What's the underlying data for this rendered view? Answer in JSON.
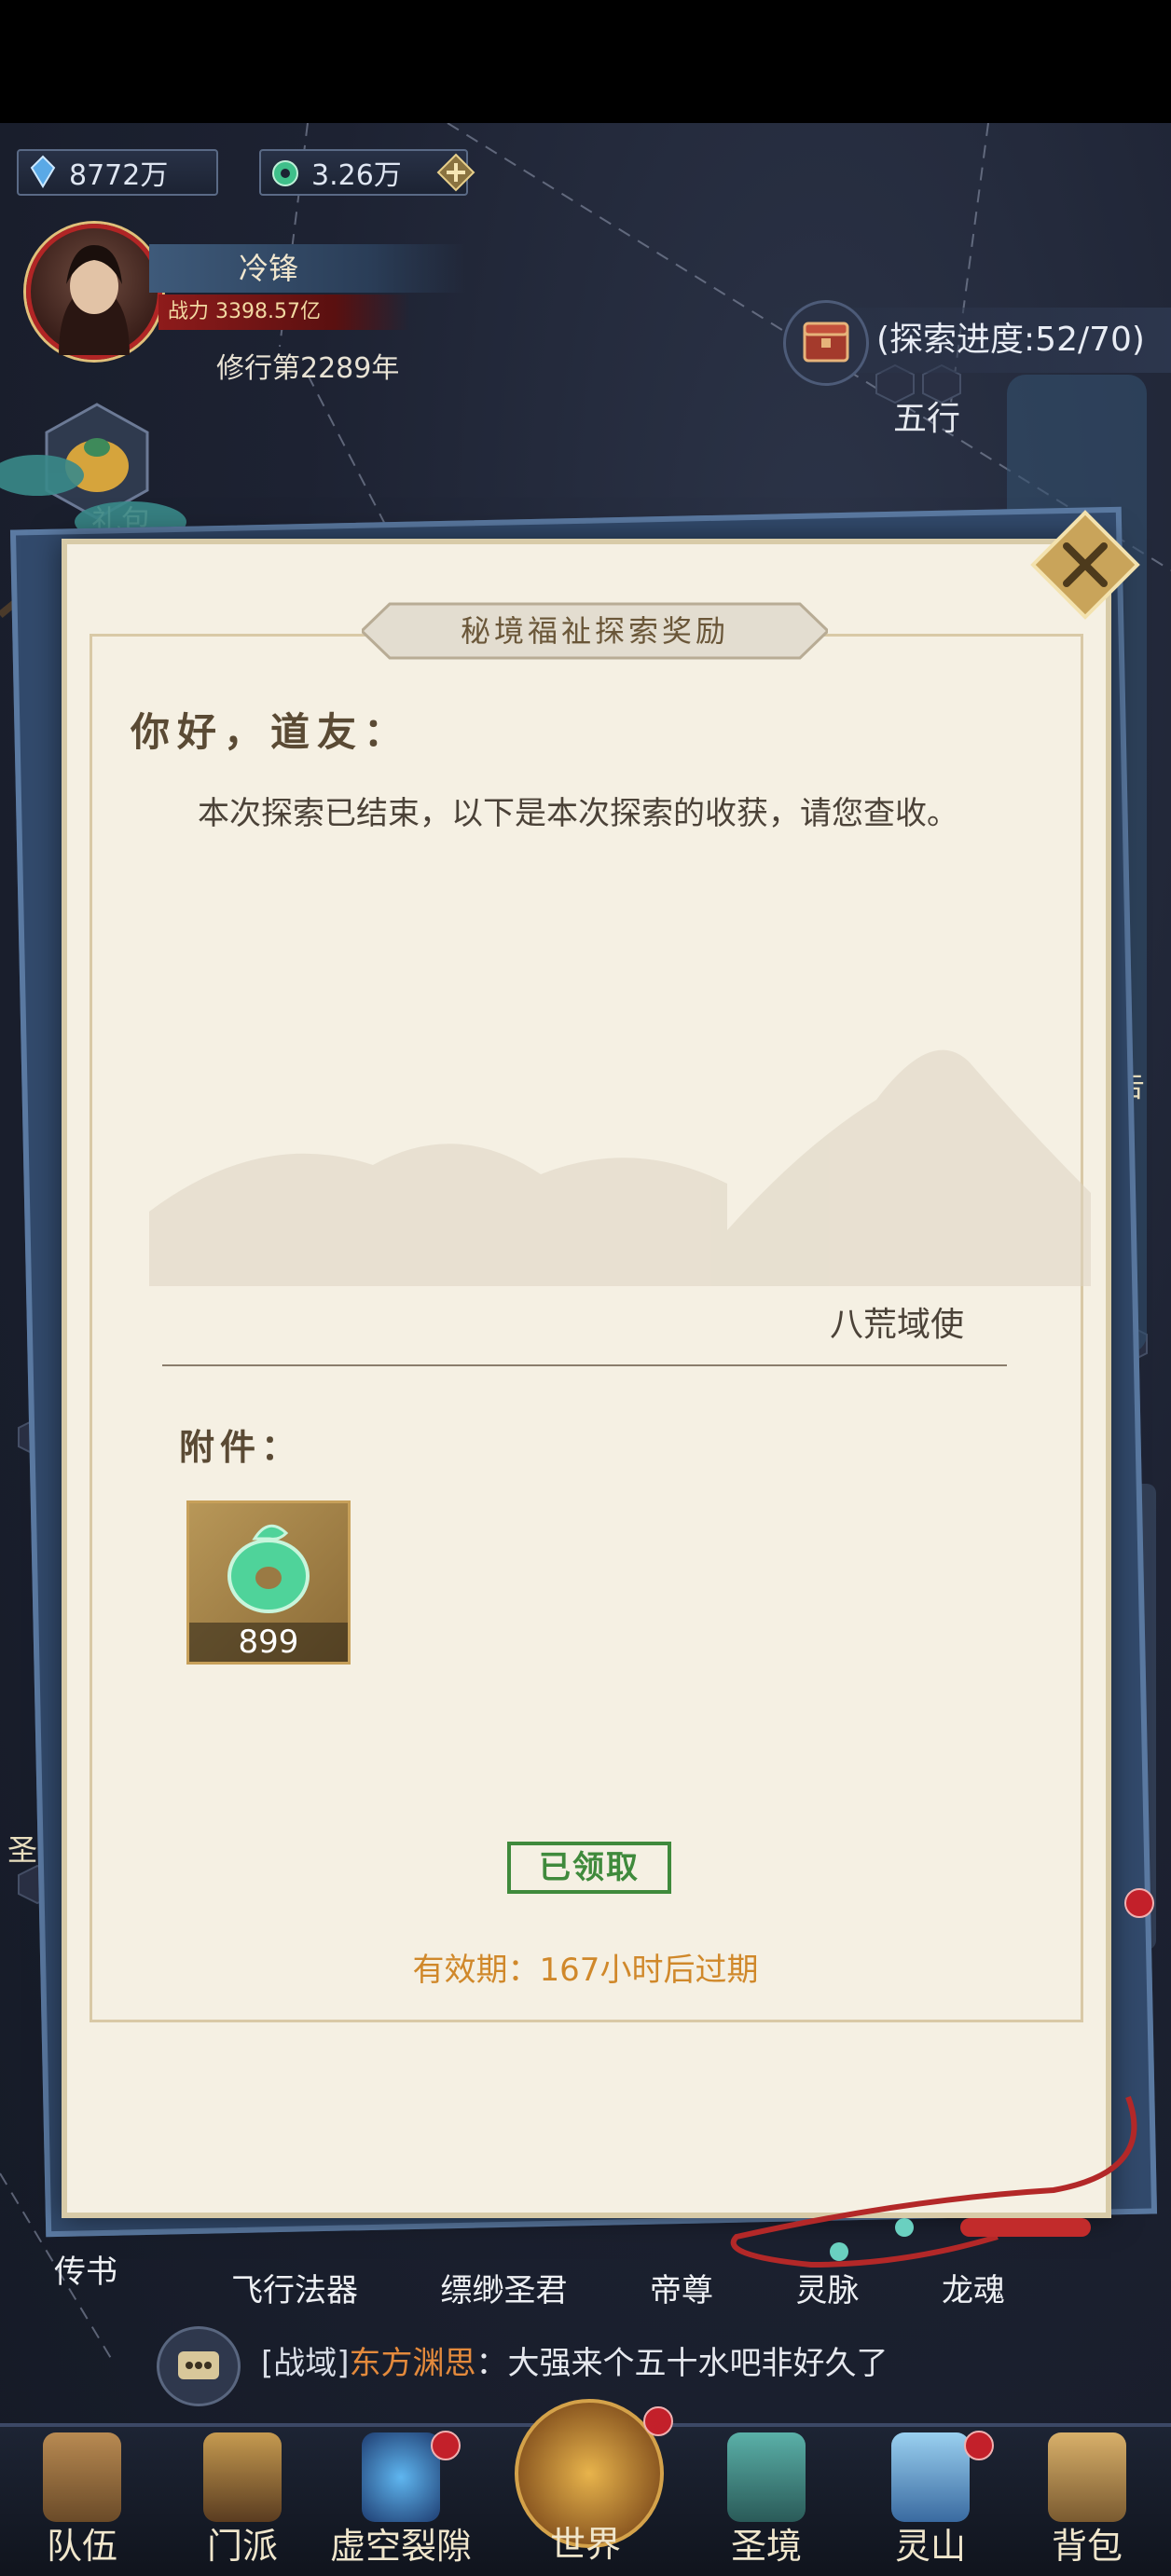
{
  "resources": {
    "spirit_stones": "8772万",
    "jade": "3.26万"
  },
  "player": {
    "name": "冷锋",
    "power": "战力 3398.57亿",
    "cultivation": "修行第2289年"
  },
  "explore_progress": "(探索进度:52/70)",
  "map_labels": {
    "wuxing": "五行",
    "gift": "礼包",
    "chuanshu": "传书",
    "side_right": "告",
    "side_left": "圣"
  },
  "modal": {
    "title": "秘境福祉探索奖励",
    "greeting": "你好，道友：",
    "body": "本次探索已结束，以下是本次探索的收获，请您查收。",
    "signer": "八荒域使",
    "attachment_label": "附件：",
    "item_qty": "899",
    "claimed_label": "已领取",
    "expiry": "有效期：167小时后过期"
  },
  "subnav": [
    "飞行法器",
    "缥缈圣君",
    "帝尊",
    "灵脉",
    "龙魂"
  ],
  "chat": {
    "channel": "[战域]",
    "sender": "东方渊思",
    "message": "：大强来个五十水吧非好久了"
  },
  "bottom_nav": [
    {
      "label": "队伍",
      "icon": "team-icon"
    },
    {
      "label": "门派",
      "icon": "sect-icon"
    },
    {
      "label": "虚空裂隙",
      "icon": "void-rift-icon"
    },
    {
      "label": "世界",
      "icon": "world-icon"
    },
    {
      "label": "圣境",
      "icon": "holy-realm-icon"
    },
    {
      "label": "灵山",
      "icon": "spirit-mountain-icon"
    },
    {
      "label": "背包",
      "icon": "bag-icon"
    }
  ],
  "colors": {
    "paper": "#f5f0e3",
    "claimed_green": "#3f8a3c",
    "expiry_orange": "#d0882a",
    "chat_sender": "#e48a3c"
  }
}
